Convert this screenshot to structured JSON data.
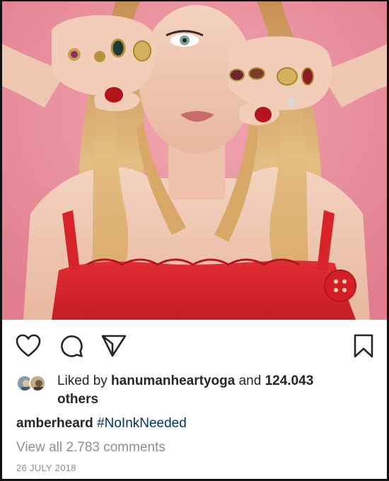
{
  "post": {
    "image_alt": "Woman in red dress holding ringed fists up to her face",
    "actions": {
      "like_icon": "heart-icon",
      "comment_icon": "comment-icon",
      "share_icon": "send-icon",
      "save_icon": "bookmark-icon"
    },
    "likes": {
      "prefix": "Liked by ",
      "user": "hanumanheartyoga",
      "connector": " and ",
      "count": "124.043",
      "suffix": "others"
    },
    "caption": {
      "username": "amberheard",
      "hashtag": "#NoInkNeeded"
    },
    "view_comments": "View all 2.783 comments",
    "date": "26 JULY 2018"
  },
  "colors": {
    "text": "#262626",
    "secondary": "#8e8e8e",
    "hashtag": "#003569",
    "photo_background": "#e98a98",
    "dress": "#d8232a"
  }
}
